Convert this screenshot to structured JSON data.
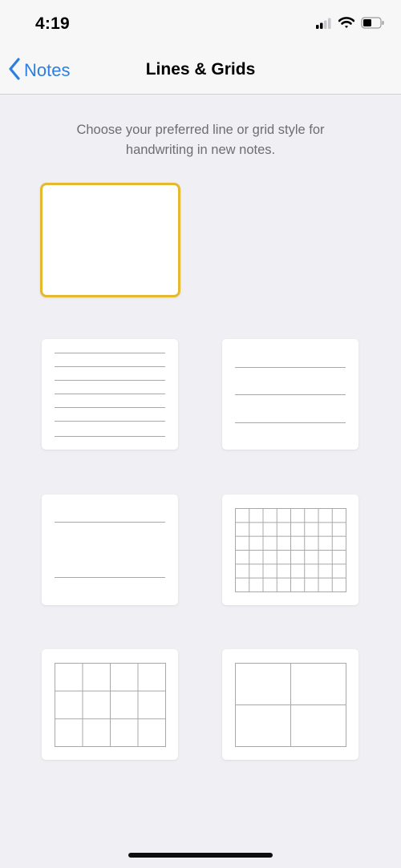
{
  "status_bar": {
    "time": "4:19",
    "icons": [
      "cellular-signal-icon",
      "wifi-icon",
      "battery-icon"
    ]
  },
  "nav": {
    "back_label": "Notes",
    "title": "Lines & Grids"
  },
  "description": "Choose your preferred line or grid style for handwriting in new notes.",
  "options": [
    {
      "name": "blank",
      "selected": true
    },
    {
      "name": "lines-small",
      "selected": false
    },
    {
      "name": "lines-medium",
      "selected": false
    },
    {
      "name": "lines-large",
      "selected": false
    },
    {
      "name": "grid-small",
      "selected": false
    },
    {
      "name": "grid-medium",
      "selected": false
    },
    {
      "name": "grid-large",
      "selected": false
    }
  ],
  "colors": {
    "accent": "#2c7ee0",
    "selection_border": "#e4b82f",
    "background": "#efeff4",
    "line": "#a8a8a8"
  }
}
